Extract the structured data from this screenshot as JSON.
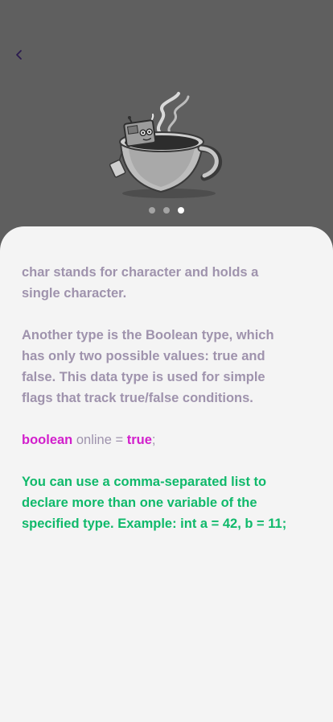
{
  "header": {
    "back_icon": "chevron-left-icon",
    "illustration": "coffee-cup-robot-illustration"
  },
  "pagination": {
    "total": 3,
    "active_index": 2
  },
  "content": {
    "paragraph1": "char stands for character and holds a single character.",
    "paragraph2": "Another type is the Boolean type, which has only two possible values: true and false. This data type is used for simple flags that track true/false conditions.",
    "code": {
      "keyword": "boolean",
      "middle": " online = ",
      "value": "true",
      "end": ";"
    },
    "paragraph3": "You can use a comma-separated list to declare more than one variable of the specified type. Example: int a = 42, b = 11;"
  },
  "colors": {
    "header_bg": "#5f5f5f",
    "card_bg": "#f4f4f4",
    "text_muted": "#9f93ad",
    "keyword": "#d21fcc",
    "green": "#10b96b"
  }
}
